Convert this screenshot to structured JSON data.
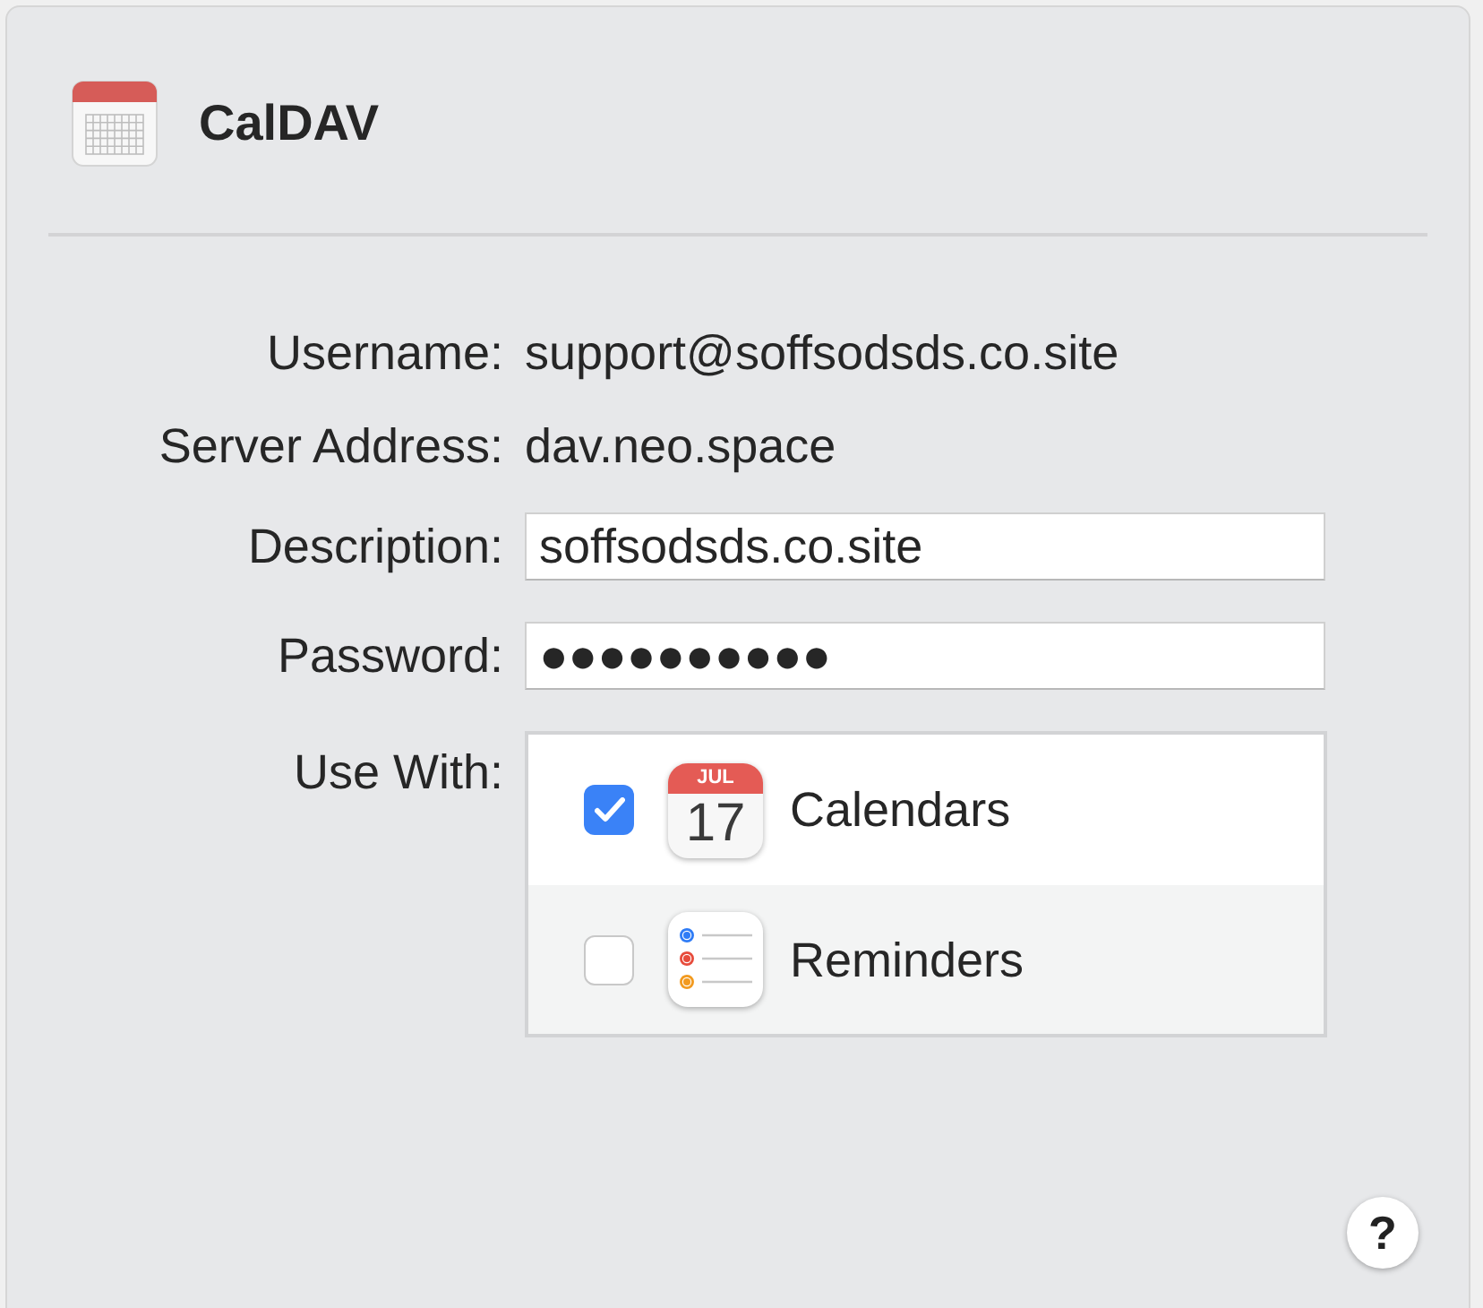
{
  "header": {
    "title": "CalDAV"
  },
  "fields": [
    {
      "kind": "text",
      "label": "Username:",
      "value": "support@soffsodsds.co.site"
    },
    {
      "kind": "text",
      "label": "Server Address:",
      "value": "dav.neo.space"
    },
    {
      "kind": "input",
      "label": "Description:",
      "value": "soffsodsds.co.site"
    },
    {
      "kind": "input",
      "label": "Password:",
      "value": "●●●●●●●●●●"
    }
  ],
  "use_with": {
    "label": "Use With:",
    "items": [
      {
        "kind": "calendar",
        "name": "Calendars",
        "checked": true,
        "icon_month": "JUL",
        "icon_day": "17"
      },
      {
        "kind": "reminders",
        "name": "Reminders",
        "checked": false
      }
    ]
  },
  "help_button": {
    "label": "?"
  }
}
